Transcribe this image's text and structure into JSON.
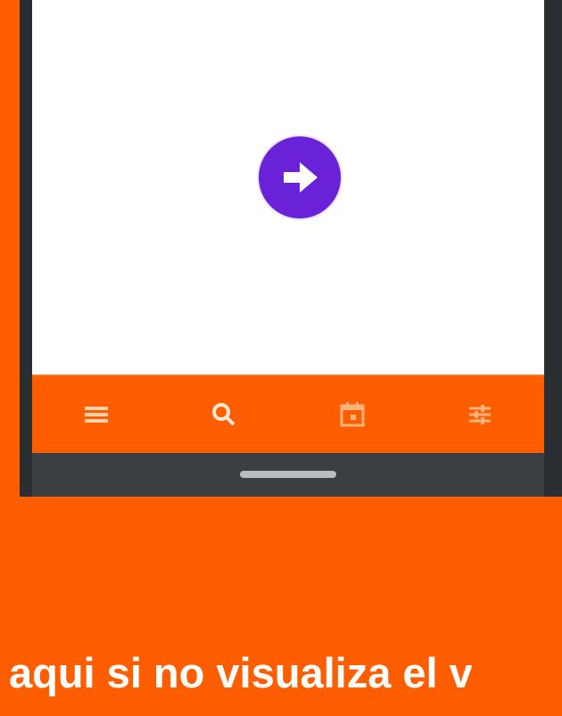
{
  "screen": {
    "center_button_icon": "arrow-right-circle-icon",
    "accent_color": "#6a22d8"
  },
  "bottom_nav": {
    "items": [
      {
        "icon": "menu-icon"
      },
      {
        "icon": "search-icon"
      },
      {
        "icon": "calendar-icon"
      },
      {
        "icon": "filter-sliders-icon"
      }
    ],
    "background_color": "#ff5e00"
  },
  "caption": {
    "text": "aqui si no visualiza el v"
  }
}
